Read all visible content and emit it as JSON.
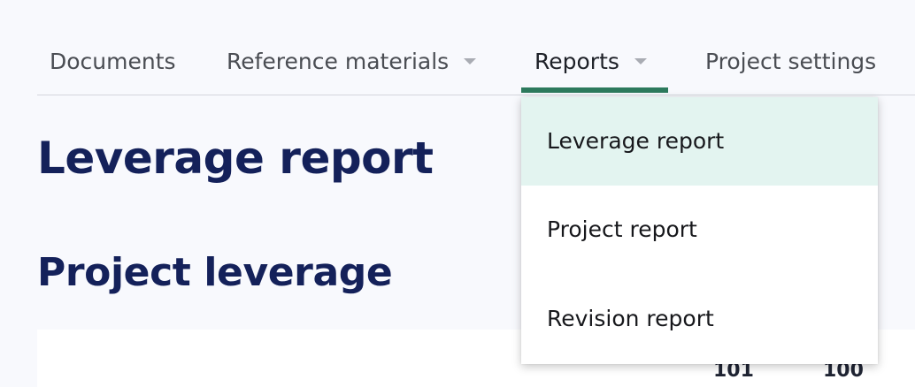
{
  "tabs": [
    {
      "label": "Documents",
      "has_dropdown": false,
      "active": false
    },
    {
      "label": "Reference materials",
      "has_dropdown": true,
      "active": false
    },
    {
      "label": "Reports",
      "has_dropdown": true,
      "active": true
    },
    {
      "label": "Project settings",
      "has_dropdown": false,
      "active": false
    }
  ],
  "colors": {
    "active_tab_underline": "#2d7a5d",
    "heading_color": "#14215a",
    "highlighted_menu_item": "#e3f4f0",
    "page_background": "#f8f9fd"
  },
  "page": {
    "title": "Leverage report",
    "section_title": "Project leverage"
  },
  "table": {
    "header_cells": [
      "101",
      "100"
    ]
  },
  "reports_menu": {
    "open": true,
    "items": [
      {
        "label": "Leverage report",
        "highlighted": true
      },
      {
        "label": "Project report",
        "highlighted": false
      },
      {
        "label": "Revision report",
        "highlighted": false
      }
    ]
  },
  "icons": {
    "dropdown_caret": "chevron-down-icon"
  }
}
